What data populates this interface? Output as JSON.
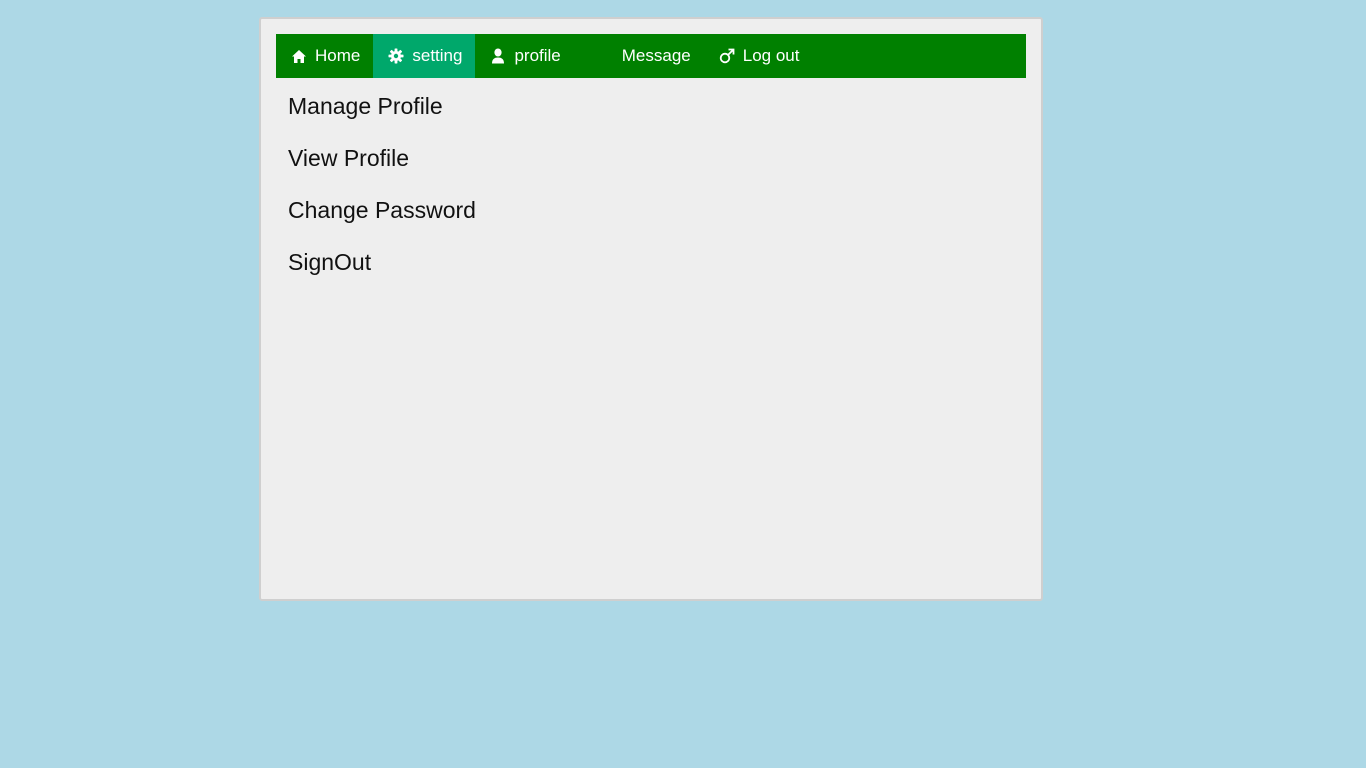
{
  "nav": {
    "items": [
      {
        "label": "Home",
        "icon": "home-icon"
      },
      {
        "label": "setting",
        "icon": "gear-icon",
        "active": true
      },
      {
        "label": "profile",
        "icon": "user-icon"
      },
      {
        "label": "Message",
        "icon": ""
      },
      {
        "label": "Log out",
        "icon": "male-symbol-icon"
      }
    ]
  },
  "menu": {
    "items": [
      {
        "label": "Manage Profile"
      },
      {
        "label": "View Profile"
      },
      {
        "label": "Change Password"
      },
      {
        "label": "SignOut"
      }
    ]
  },
  "colors": {
    "background": "#add8e6",
    "panel": "#eeeeee",
    "navbar": "#008000",
    "nav_active": "#00a86b",
    "nav_text": "#ffffff",
    "menu_text": "#111111"
  }
}
